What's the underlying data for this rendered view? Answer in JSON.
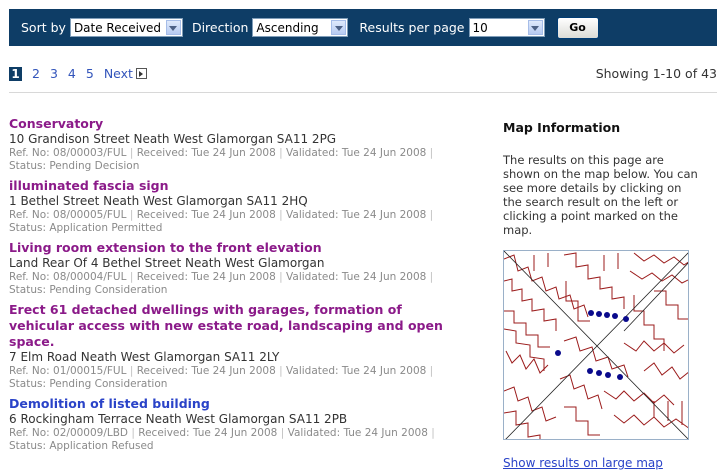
{
  "sort": {
    "sort_by_label": "Sort by",
    "sort_by_value": "Date Received",
    "direction_label": "Direction",
    "direction_value": "Ascending",
    "per_page_label": "Results per page",
    "per_page_value": "10",
    "go_label": "Go"
  },
  "pager": {
    "current": "1",
    "pages": [
      "2",
      "3",
      "4",
      "5"
    ],
    "next_label": "Next",
    "showing": "Showing 1-10 of 43"
  },
  "results": [
    {
      "title": "Conservatory",
      "address": "10 Grandison Street Neath West Glamorgan SA11 2PG",
      "ref": "Ref. No: 08/00003/FUL",
      "received": "Received: Tue 24 Jun 2008",
      "validated": "Validated: Tue 24 Jun 2008",
      "status": "Status: Pending Decision"
    },
    {
      "title": "illuminated fascia sign",
      "address": "1 Bethel Street Neath West Glamorgan SA11 2HQ",
      "ref": "Ref. No: 08/00005/FUL",
      "received": "Received: Tue 24 Jun 2008",
      "validated": "Validated: Tue 24 Jun 2008",
      "status": "Status: Application Permitted"
    },
    {
      "title": "Living room extension to the front elevation",
      "address": "Land Rear Of 4 Bethel Street Neath West Glamorgan",
      "ref": "Ref. No: 08/00004/FUL",
      "received": "Received: Tue 24 Jun 2008",
      "validated": "Validated: Tue 24 Jun 2008",
      "status": "Status: Pending Consideration"
    },
    {
      "title": "Erect 61 detached dwellings with garages, formation of vehicular access with new estate road, landscaping and open space.",
      "address": "7 Elm Road Neath West Glamorgan SA11 2LY",
      "ref": "Ref. No: 01/00015/FUL",
      "received": "Received: Tue 24 Jun 2008",
      "validated": "Validated: Tue 24 Jun 2008",
      "status": "Status: Pending Consideration"
    },
    {
      "title": "Demolition of listed building",
      "address": "6 Rockingham Terrace Neath West Glamorgan SA11 2PB",
      "ref": "Ref. No: 02/00009/LBD",
      "received": "Received: Tue 24 Jun 2008",
      "validated": "Validated: Tue 24 Jun 2008",
      "status": "Status: Application Refused"
    }
  ],
  "map": {
    "heading": "Map Information",
    "description": "The results on this page are shown on the map below. You can see more details by clicking on the search result on the left or clicking a point marked on the map.",
    "large_link": "Show results on large map"
  },
  "colors": {
    "bar": "#0e3d66",
    "title_visited": "#8b1a89",
    "title_link": "#2a43c8",
    "map_lines": "#9b1b1b",
    "map_points": "#0a0a8c"
  }
}
